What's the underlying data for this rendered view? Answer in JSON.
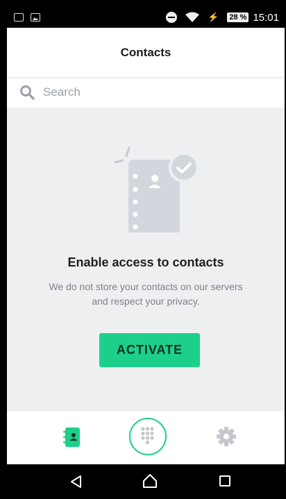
{
  "status_bar": {
    "battery": "28 %",
    "time": "15:01",
    "left_icons": [
      "notification-icon",
      "image-icon"
    ],
    "right_icons": [
      "do-not-disturb-icon",
      "wifi-icon",
      "charging-icon",
      "battery-icon"
    ]
  },
  "header": {
    "title": "Contacts"
  },
  "search": {
    "placeholder": "Search",
    "value": "",
    "icon": "search-icon"
  },
  "empty_state": {
    "illustration": "contacts-book-check-icon",
    "title": "Enable access to contacts",
    "description": "We do not store your contacts on our servers and respect your privacy.",
    "button_label": "ACTIVATE"
  },
  "bottom_nav": {
    "items": [
      {
        "icon": "contacts-book-icon",
        "active": true
      },
      {
        "icon": "dialpad-icon",
        "active": false
      },
      {
        "icon": "gear-icon",
        "active": false
      }
    ]
  },
  "system_nav": {
    "icons": [
      "back-icon",
      "home-icon",
      "recents-icon"
    ]
  },
  "colors": {
    "accent": "#1cd08b",
    "background": "#eeeff1",
    "illustration": "#cdd1d7",
    "text_primary": "#1e1e1e",
    "text_secondary": "#7d8186",
    "icon_inactive": "#c4c7cc"
  }
}
